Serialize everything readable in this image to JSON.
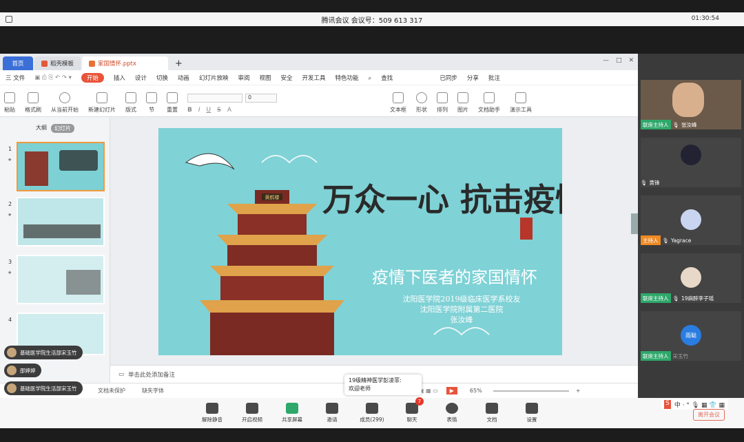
{
  "meeting": {
    "title": "腾讯会议 会议号：509 613 317",
    "clock": "01:30:54"
  },
  "tabs": [
    {
      "label": "首页"
    },
    {
      "label": "稻壳模板"
    },
    {
      "label": "家国情怀.pptx"
    }
  ],
  "menu": {
    "file": "三 文件",
    "start": "开始",
    "items": [
      "插入",
      "设计",
      "切换",
      "动画",
      "幻灯片放映",
      "审阅",
      "视图",
      "安全",
      "开发工具",
      "特色功能",
      "查找"
    ],
    "right": [
      "已同步",
      "分享",
      "批注"
    ],
    "user": "张汝峰"
  },
  "ribbon": {
    "groups": [
      "粘贴",
      "格式刷",
      "从当前开始",
      "新建幻灯片",
      "版式",
      "节",
      "重置"
    ],
    "font_size": "0",
    "right_groups": [
      "文本框",
      "形状",
      "排列",
      "图片",
      "查找",
      "文档助手",
      "演示工具"
    ]
  },
  "panel": {
    "tab_outline": "大纲",
    "tab_slides": "幻灯片",
    "numbers": [
      "1",
      "2",
      "3",
      "4"
    ]
  },
  "slide": {
    "calligraphy": "万众一心 抗击疫情",
    "subtitle": "疫情下医者的家国情怀",
    "line1": "沈阳医学院2019级临床医学系校友",
    "line2": "沈阳医学院附属第二医院",
    "line3": "张汝峰",
    "plaque": "黄鹤楼"
  },
  "notes_hint": "单击此处添加备注",
  "status": {
    "protect": "文档未保护",
    "font": "缺失字体",
    "zoom": "65%"
  },
  "chat": [
    {
      "text": "基础医学院生活部宋玉竹"
    },
    {
      "text": "邵婷婷"
    },
    {
      "text": "基础医学院生活部宋玉竹"
    }
  ],
  "popup": {
    "sender": "19级精神医学彭凌菲:",
    "message": "欢迎老师"
  },
  "participants": [
    {
      "role": "联席主持人",
      "name": "张汝峰"
    },
    {
      "role": "",
      "name": "黄锋"
    },
    {
      "role": "主持人",
      "name": "Yagrace"
    },
    {
      "role": "联席主持人",
      "name": "19麻醉李子瑶"
    },
    {
      "role": "联席主持人",
      "name": "宋玉竹",
      "avatar_text": "雨聪"
    }
  ],
  "toolbar": {
    "buttons": [
      "解除静音",
      "开启视频",
      "共享屏幕",
      "邀请",
      "成员(299)",
      "聊天",
      "表情",
      "文档",
      "设置"
    ],
    "chat_badge": "7",
    "leave": "离开会议"
  },
  "colors": {
    "accent": "#3b6fd8",
    "start": "#e8543a",
    "slide_bg": "#7fd2d6",
    "host": "#f08a24",
    "cohost": "#2ea86a"
  }
}
